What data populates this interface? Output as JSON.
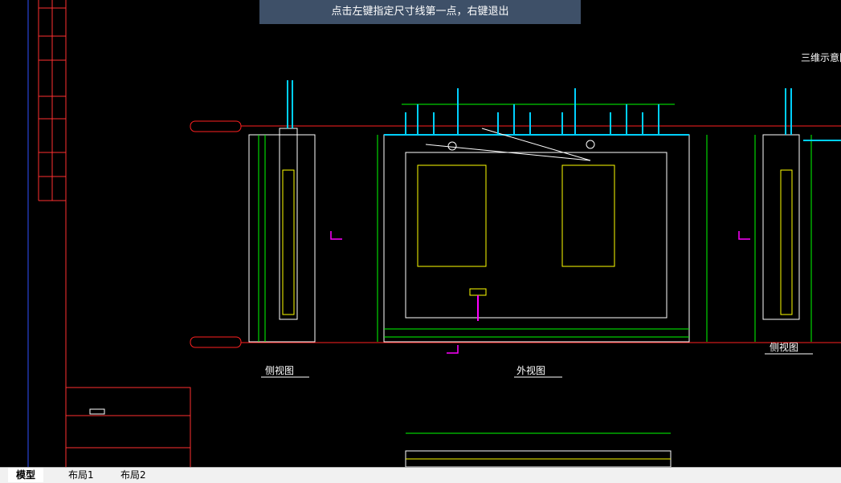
{
  "command_prompt": "点击左键指定尺寸线第一点，右键退出",
  "tabs": [
    "模型",
    "布局1",
    "布局2"
  ],
  "drawing": {
    "labels": {
      "view_3d": "三维示意图",
      "side_view_left": "侧视图",
      "outer_view": "外视图",
      "side_view_right": "侧视图"
    }
  },
  "colors": {
    "background": "#000000",
    "prompt_bg": "#3e5068",
    "dim_green": "#00ff00",
    "red": "#ff0000",
    "yellow": "#ffff00",
    "cyan": "#00d0ff",
    "white": "#ffffff",
    "magenta": "#ff00ff"
  }
}
